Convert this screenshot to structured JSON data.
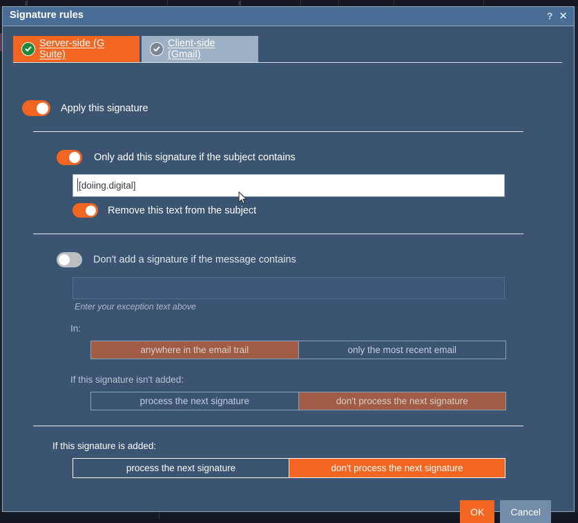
{
  "window": {
    "title": "Signature rules",
    "help_icon": "?",
    "close_icon": "✕"
  },
  "tabs": [
    {
      "label": "Server-side (G Suite)",
      "icon": "check-circle-green-icon",
      "active": true
    },
    {
      "label": "Client-side (Gmail)",
      "icon": "check-circle-gray-icon",
      "active": false
    }
  ],
  "apply": {
    "label": "Apply this signature",
    "state": "on"
  },
  "subject_rule": {
    "label": "Only add this signature if the subject contains",
    "state": "on",
    "value": "[doiing.digital]",
    "placeholder": "",
    "remove_label": "Remove this text from the subject",
    "remove_state": "on"
  },
  "exception_rule": {
    "label": "Don't add a signature if the message contains",
    "state": "off",
    "value": "",
    "hint": "Enter your exception text above",
    "in_label": "In:",
    "in_options": [
      "anywhere in the email trail",
      "only the most recent email"
    ],
    "in_selected": 0,
    "not_added_label": "If this signature isn't added:",
    "not_added_options": [
      "process the next signature",
      "don't process the next signature"
    ],
    "not_added_selected": 1
  },
  "added_rule": {
    "label": "If this signature is added:",
    "options": [
      "process the next signature",
      "don't process the next signature"
    ],
    "selected": 1
  },
  "footer": {
    "ok_label": "OK",
    "cancel_label": "Cancel"
  },
  "colors": {
    "accent_orange": "#f26621",
    "dialog_bg": "#3a5472",
    "titlebar_bg": "#4a6d96",
    "muted_orange": "#a15c45",
    "toggle_off": "#b9bec4",
    "check_green": "#1a8a38",
    "check_gray": "#7b8694"
  }
}
